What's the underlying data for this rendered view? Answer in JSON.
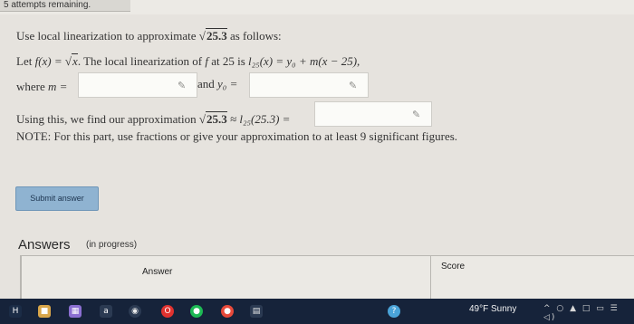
{
  "header": {
    "attempts": "5 attempts remaining."
  },
  "problem": {
    "instruction_pre": "Use local linearization to approximate",
    "sqrt_value": "25.3",
    "instruction_post": "as follows:",
    "let_text": "Let",
    "f_def_lhs": "f(x) =",
    "f_def_radicand": "x",
    "mid_text": ". The local linearization of",
    "f_symbol": "f",
    "at_text": "at 25 is",
    "linearization": "l₂₅(x) = y₀ + m(x − 25),",
    "where_text": "where",
    "m_label": "m =",
    "and_text": "and",
    "y0_label": "y₀ =",
    "using_text": "Using this, we find our approximation",
    "approx_sqrt": "25.3",
    "approx_rhs": "≈ l₂₅(25.3) =",
    "note": "NOTE: For this part, use fractions or give your approximation to at least 9 significant figures.",
    "pencil_glyph": "✎"
  },
  "submit": {
    "label": "Submit answer"
  },
  "answers": {
    "title": "Answers",
    "status": "(in progress)",
    "col_answer": "Answer",
    "col_score": "Score"
  },
  "taskbar": {
    "icons": [
      {
        "name": "app-icon",
        "glyph": "H",
        "color": "#1b2c46"
      },
      {
        "name": "file-explorer-icon",
        "glyph": "■",
        "color": "#d9a64a"
      },
      {
        "name": "calendar-icon",
        "glyph": "▦",
        "color": "#8b6fd1"
      },
      {
        "name": "amazon-icon",
        "glyph": "a",
        "color": "#ffffff"
      },
      {
        "name": "browser-icon",
        "glyph": "◉",
        "color": "#eaeaea"
      },
      {
        "name": "opera-icon",
        "glyph": "O",
        "color": "#e0322f"
      },
      {
        "name": "spotify-icon",
        "glyph": "●",
        "color": "#1db954"
      },
      {
        "name": "chrome-icon",
        "glyph": "●",
        "color": "#e84a3b"
      },
      {
        "name": "notes-icon",
        "glyph": "▤",
        "color": "#e9e9e9"
      },
      {
        "name": "question-icon",
        "glyph": "?",
        "color": "#4aa3d8"
      }
    ],
    "weather": "49°F  Sunny",
    "tray_glyphs": "^ ○ ▲ □ ▭ ☰ ◁)"
  }
}
